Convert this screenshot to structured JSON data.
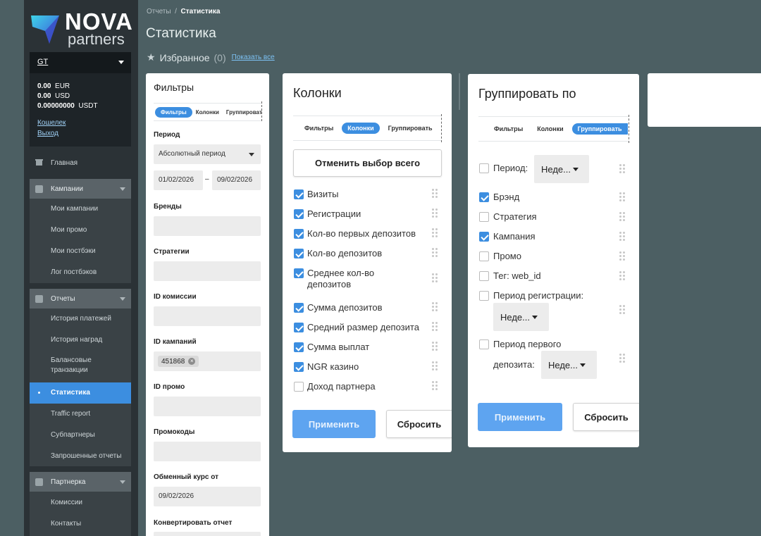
{
  "sidebar": {
    "logo_top": "NOVA",
    "logo_bottom": "partners",
    "account": {
      "selected": "GT",
      "balances": [
        {
          "amount": "0.00",
          "currency": "EUR"
        },
        {
          "amount": "0.00",
          "currency": "USD"
        },
        {
          "amount": "0.00000000",
          "currency": "USDT"
        }
      ],
      "wallet_link": "Кошелек",
      "logout_link": "Выход"
    },
    "home": "Главная",
    "campaigns": {
      "label": "Кампании",
      "items": [
        "Мои кампании",
        "Мои промо",
        "Мои постбэки",
        "Лог постбэков"
      ]
    },
    "reports": {
      "label": "Отчеты",
      "items": [
        "История платежей",
        "История наград",
        "Балансовые транзакции",
        "Статистика",
        "Traffic report",
        "Субпартнеры",
        "Запрошенные отчеты"
      ],
      "active": "Статистика"
    },
    "partner": {
      "label": "Партнерка",
      "items": [
        "Комиссии",
        "Контакты"
      ]
    }
  },
  "header": {
    "breadcrumb_root": "Отчеты",
    "breadcrumb_sep": "/",
    "breadcrumb_current": "Статистика",
    "title": "Статистика",
    "favorites_label": "Избранное",
    "favorites_count": "(0)",
    "show_all": "Показать все"
  },
  "filters_panel": {
    "title": "Фильтры",
    "tabs": [
      "Фильтры",
      "Колонки",
      "Группировать"
    ],
    "period_label": "Период",
    "period_value": "Абсолютный период",
    "date_from": "01/02/2026",
    "date_sep": "–",
    "date_to": "09/02/2026",
    "brands_label": "Бренды",
    "strategies_label": "Стратегии",
    "commission_id_label": "ID комиссии",
    "campaign_id_label": "ID кампаний",
    "campaign_chip": "451868",
    "promo_id_label": "ID промо",
    "promocodes_label": "Промокоды",
    "rate_label": "Обменный курс от",
    "rate_value": "09/02/2026",
    "convert_label": "Конвертировать отчет"
  },
  "columns_panel": {
    "title": "Колонки",
    "tabs": [
      "Фильтры",
      "Колонки",
      "Группировать"
    ],
    "deselect_all": "Отменить выбор всего",
    "items": [
      {
        "label": "Визиты",
        "checked": true
      },
      {
        "label": "Регистрации",
        "checked": true
      },
      {
        "label": "Кол-во первых депозитов",
        "checked": true
      },
      {
        "label": "Кол-во депозитов",
        "checked": true
      },
      {
        "label": "Среднее кол-во депозитов",
        "checked": true
      },
      {
        "label": "Сумма депозитов",
        "checked": true
      },
      {
        "label": "Средний размер депозита",
        "checked": true
      },
      {
        "label": "Сумма выплат",
        "checked": true
      },
      {
        "label": "NGR казино",
        "checked": true
      },
      {
        "label": "Доход партнера",
        "checked": false
      }
    ],
    "apply": "Применить",
    "reset": "Сбросить"
  },
  "group_panel": {
    "title": "Группировать по",
    "tabs": [
      "Фильтры",
      "Колонки",
      "Группировать"
    ],
    "period_label": "Период:",
    "period_value": "Неде...",
    "brand": "Брэнд",
    "strategy": "Стратегия",
    "campaign": "Кампания",
    "promo": "Промо",
    "tag": "Тег: web_id",
    "reg_period_label": "Период регистрации:",
    "reg_period_value": "Неде...",
    "first_dep_label_1": "Период первого",
    "first_dep_label_2": "депозита:",
    "first_dep_value": "Неде...",
    "checks": {
      "period": false,
      "brand": true,
      "strategy": false,
      "campaign": true,
      "promo": false,
      "tag": false,
      "reg_period": false,
      "first_dep": false
    },
    "apply": "Применить",
    "reset": "Сбросить"
  }
}
